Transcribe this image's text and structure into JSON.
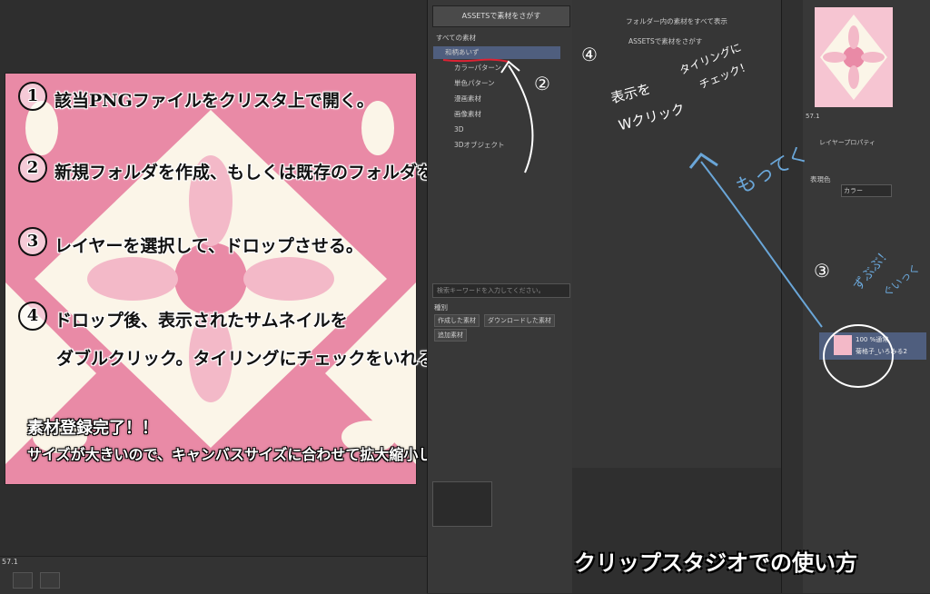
{
  "colors": {
    "canvas_pink": "#e98aa6",
    "canvas_cream": "#fbf5e8",
    "selection_blue": "#4f5e7e",
    "annotation_blue": "#6aa6d8"
  },
  "steps": [
    {
      "num": "1",
      "text": "該当PNGファイルをクリスタ上で開く。"
    },
    {
      "num": "2",
      "text": "新規フォルダを作成、もしくは既存のフォルダをえらぶ。"
    },
    {
      "num": "3",
      "text": "レイヤーを選択して、ドロップさせる。"
    },
    {
      "num": "4",
      "text": "ドロップ後、表示されたサムネイルを"
    },
    {
      "num": "",
      "text": "ダブルクリック。タイリングにチェックをいれる。"
    }
  ],
  "complete": {
    "line1": "素材登録完了！！",
    "line2": "サイズが大きいので、キャンバスサイズに合わせて拡大縮小してあげてください。"
  },
  "footer_title": "クリップスタジオでの使い方",
  "material_panel": {
    "assets_button": "ASSETSで素材をさがす",
    "tree": [
      "すべての素材",
      "和柄あいず",
      "カラーパターン",
      "単色パターン",
      "漫画素材",
      "画像素材",
      "3D",
      "3Dオブジェクト"
    ],
    "search_placeholder": "検索キーワードを入力してください。",
    "kind_label": "種別",
    "tags": [
      "作成した素材",
      "ダウンロードした素材",
      "追加素材"
    ]
  },
  "center_panel": {
    "title": "フォルダー内の素材をすべて表示",
    "assets_link": "ASSETSで素材をさがす"
  },
  "right_panel": {
    "layer_property_tab": "レイヤープロパティ",
    "expression_label": "表現色",
    "expression_value": "カラー",
    "layer_mode": "100 %通常",
    "layer_name": "菊格子_いろみる2",
    "zoom": "57.1"
  },
  "annotations": {
    "num2": "②",
    "num3": "③",
    "num4": "④",
    "steps4": "表示を",
    "steps4b": "Wクリック",
    "tiling": "タイリングに",
    "check": "チェック！",
    "motteku": "もってく",
    "zubu": "ずぶぶ！",
    "gui": "ぐいっく"
  },
  "bottom_bar": {
    "zoom": "57.1"
  }
}
